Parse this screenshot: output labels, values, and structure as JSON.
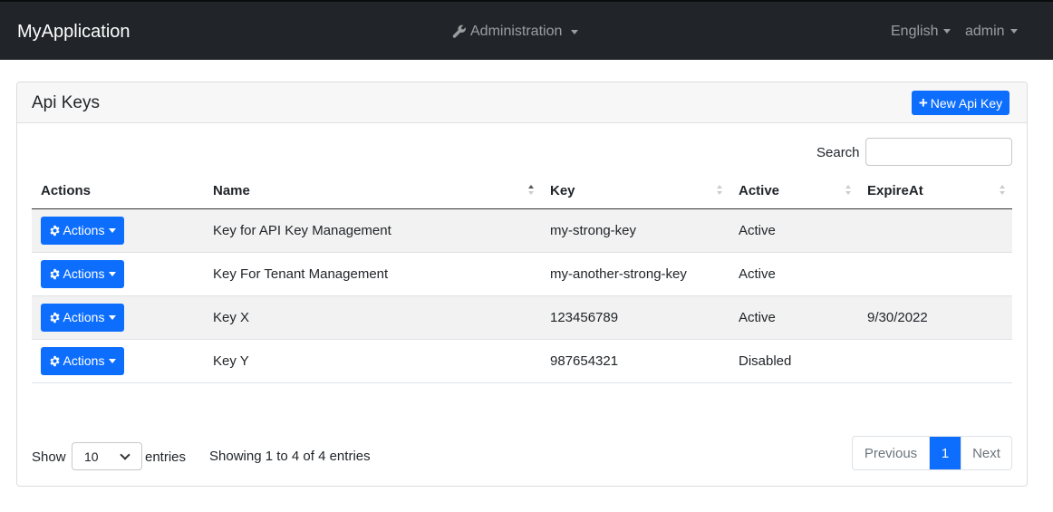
{
  "navbar": {
    "brand": "MyApplication",
    "admin_label": "Administration",
    "language_label": "English",
    "user_label": "admin"
  },
  "card": {
    "title": "Api Keys",
    "new_button_label": "New Api Key"
  },
  "search": {
    "label": "Search",
    "value": ""
  },
  "table": {
    "headers": [
      "Actions",
      "Name",
      "Key",
      "Active",
      "ExpireAt"
    ],
    "rows": [
      {
        "action_label": "Actions",
        "name": "Key for API Key Management",
        "key": "my-strong-key",
        "active": "Active",
        "expire_at": ""
      },
      {
        "action_label": "Actions",
        "name": "Key For Tenant Management",
        "key": "my-another-strong-key",
        "active": "Active",
        "expire_at": ""
      },
      {
        "action_label": "Actions",
        "name": "Key X",
        "key": "123456789",
        "active": "Active",
        "expire_at": "9/30/2022"
      },
      {
        "action_label": "Actions",
        "name": "Key Y",
        "key": "987654321",
        "active": "Disabled",
        "expire_at": ""
      }
    ]
  },
  "footer": {
    "show_label": "Show",
    "page_length": "10",
    "entries_label": "entries",
    "info": "Showing 1 to 4 of 4 entries",
    "prev_label": "Previous",
    "current_page": "1",
    "next_label": "Next"
  },
  "colors": {
    "navbar_bg": "#212529",
    "primary": "#0d6efd"
  }
}
